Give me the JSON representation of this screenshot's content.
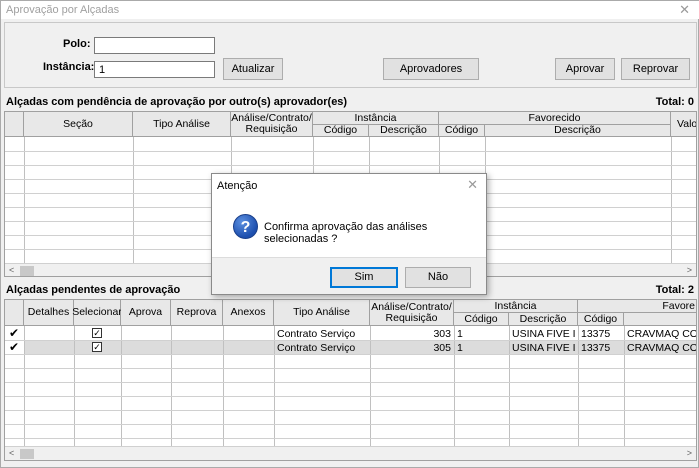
{
  "window": {
    "title": "Aprovação por Alçadas",
    "close_glyph": "✕"
  },
  "filters": {
    "polo_label": "Polo:",
    "polo_value": "",
    "instancia_label": "Instância:",
    "instancia_value": "1",
    "atualizar_label": "Atualizar",
    "aprovadores_label": "Aprovadores",
    "aprovar_label": "Aprovar",
    "reprovar_label": "Reprovar"
  },
  "top_section": {
    "title": "Alçadas com pendência de aprovação por outro(s) aprovador(es)",
    "total": "Total: 0",
    "headers": {
      "secao": "Seção",
      "tipo": "Tipo Análise",
      "analise": "Análise/Contrato/ Requisição",
      "instancia": "Instância",
      "inst_codigo": "Código",
      "inst_desc": "Descrição",
      "favorecido": "Favorecido",
      "fav_codigo": "Código",
      "fav_desc": "Descrição",
      "valor": "Valor"
    }
  },
  "bottom_section": {
    "title": "Alçadas pendentes de aprovação",
    "total": "Total: 2",
    "headers": {
      "detalhes": "Detalhes",
      "selecionar": "Selecionar",
      "aprova": "Aprova",
      "reprova": "Reprova",
      "anexos": "Anexos",
      "tipo": "Tipo Análise",
      "analise": "Análise/Contrato/ Requisição",
      "instancia": "Instância",
      "inst_codigo": "Código",
      "inst_desc": "Descrição",
      "favorecido": "Favore",
      "fav_codigo": "Código"
    },
    "rows": [
      {
        "check": "✔",
        "selected": "✓",
        "tipo": "Contrato Serviço",
        "numero": "303",
        "inst_codigo": "1",
        "inst_desc": "USINA FIVE I",
        "fav_codigo": "13375",
        "fav_desc": "CRAVMAQ COM E"
      },
      {
        "check": "✔",
        "selected": "✓",
        "tipo": "Contrato Serviço",
        "numero": "305",
        "inst_codigo": "1",
        "inst_desc": "USINA FIVE I",
        "fav_codigo": "13375",
        "fav_desc": "CRAVMAQ COM E"
      }
    ]
  },
  "dialog": {
    "title": "Atenção",
    "close_glyph": "✕",
    "icon_glyph": "?",
    "message": "Confirma aprovação das análises selecionadas ?",
    "yes_label": "Sim",
    "no_label": "Não"
  },
  "scroll": {
    "left": "<",
    "right": ">"
  }
}
